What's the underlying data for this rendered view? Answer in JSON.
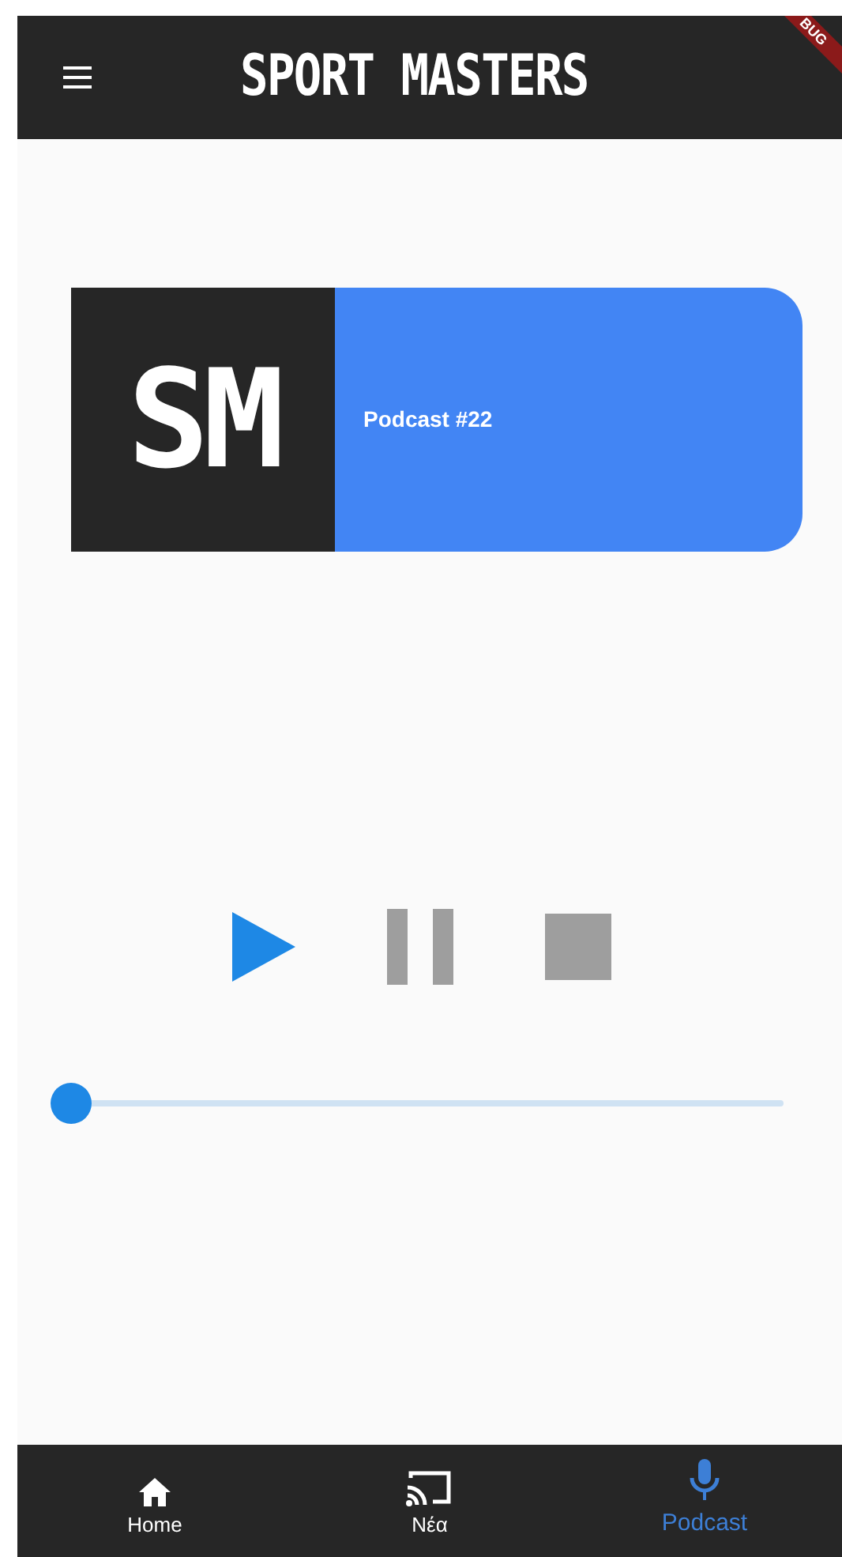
{
  "app_bar": {
    "title": "SPORT MASTERS",
    "debug_banner": "BUG"
  },
  "episode": {
    "logo": "SM",
    "title": "Podcast #22"
  },
  "controls": [
    {
      "kind": "play",
      "enabled": true
    },
    {
      "kind": "pause",
      "enabled": false
    },
    {
      "kind": "stop",
      "enabled": false
    }
  ],
  "progress": {
    "level": 0
  },
  "bottom_nav": [
    {
      "kind": "home",
      "label": "Home",
      "selected": false
    },
    {
      "kind": "cast",
      "label": "Νέα",
      "selected": false
    },
    {
      "kind": "mic",
      "label": "Podcast",
      "selected": true
    }
  ]
}
